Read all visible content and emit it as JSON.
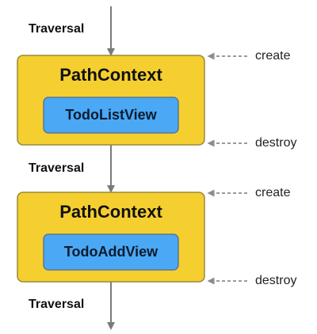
{
  "traversal_labels": [
    "Traversal",
    "Traversal",
    "Traversal"
  ],
  "contexts": [
    {
      "title": "PathContext",
      "view": "TodoListView",
      "create_label": "create",
      "destroy_label": "destroy"
    },
    {
      "title": "PathContext",
      "view": "TodoAddView",
      "create_label": "create",
      "destroy_label": "destroy"
    }
  ],
  "colors": {
    "context_fill": "#f5cf2f",
    "context_stroke": "#9a8a3c",
    "view_fill": "#4aa8f5",
    "view_stroke": "#5f7690",
    "arrow": "#7a7a7a",
    "dashed_arrow": "#8c8c8c"
  }
}
